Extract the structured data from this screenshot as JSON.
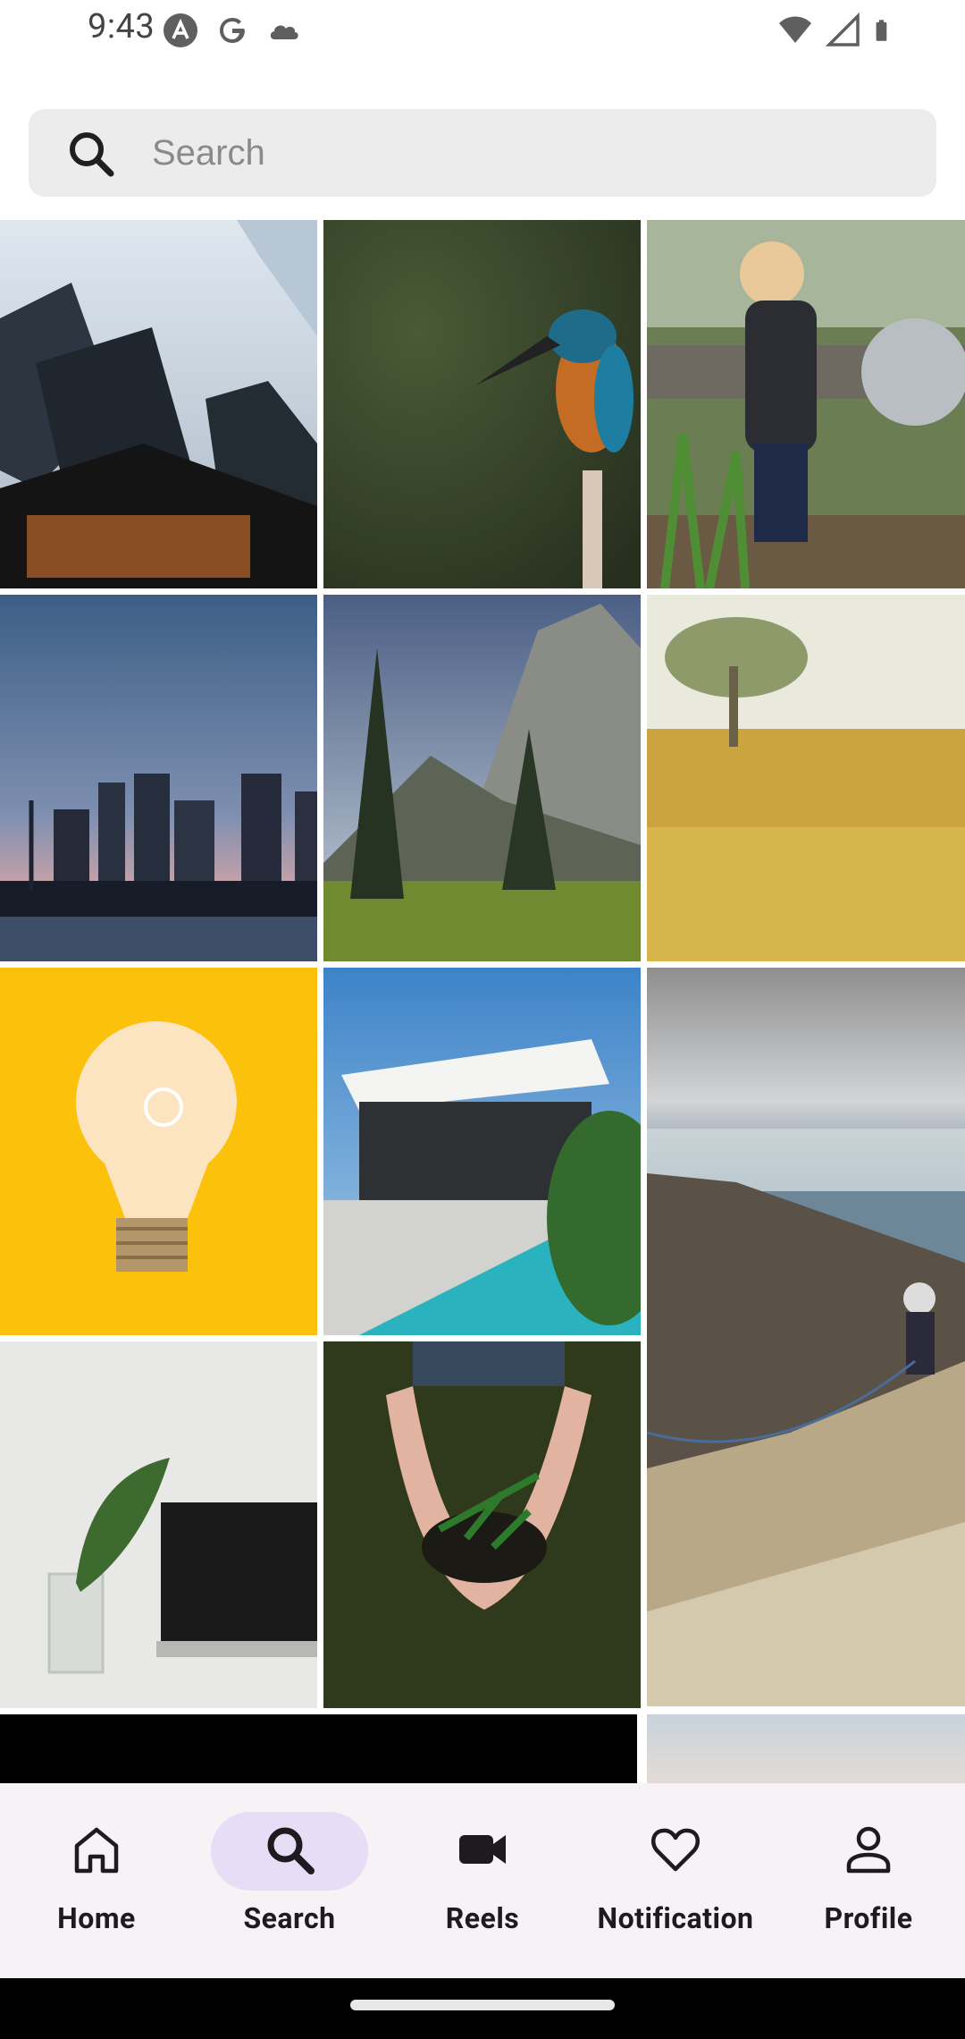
{
  "status_bar": {
    "time": "9:43",
    "left_icons": [
      "app-a-icon",
      "google-icon",
      "cloud-icon"
    ],
    "right_icons": [
      "wifi-icon",
      "signal-icon",
      "battery-icon"
    ]
  },
  "search": {
    "placeholder": "Search",
    "value": ""
  },
  "grid": {
    "tiles": [
      {
        "subject": "skyscrapers"
      },
      {
        "subject": "kingfisher bird"
      },
      {
        "subject": "child watering plants"
      },
      {
        "subject": "city skyline at dusk"
      },
      {
        "subject": "mountain and pine forest"
      },
      {
        "subject": "tree in yellow flower field"
      },
      {
        "subject": "light bulb on yellow"
      },
      {
        "subject": "modern house with pool"
      },
      {
        "subject": "hiker on mountain ridge"
      },
      {
        "subject": "laptop and plant"
      },
      {
        "subject": "hands holding soil and plant"
      },
      {
        "subject": "black photo"
      },
      {
        "subject": "sky photo"
      }
    ]
  },
  "nav": {
    "items": [
      {
        "label": "Home",
        "icon": "home-icon",
        "active": false
      },
      {
        "label": "Search",
        "icon": "search-icon",
        "active": true
      },
      {
        "label": "Reels",
        "icon": "video-camera-icon",
        "active": false
      },
      {
        "label": "Notification",
        "icon": "heart-icon",
        "active": false
      },
      {
        "label": "Profile",
        "icon": "person-icon",
        "active": false
      }
    ]
  },
  "colors": {
    "accent_pill": "#e8ddf7",
    "nav_bg": "#f6f2f6",
    "search_bg": "#ececec"
  }
}
